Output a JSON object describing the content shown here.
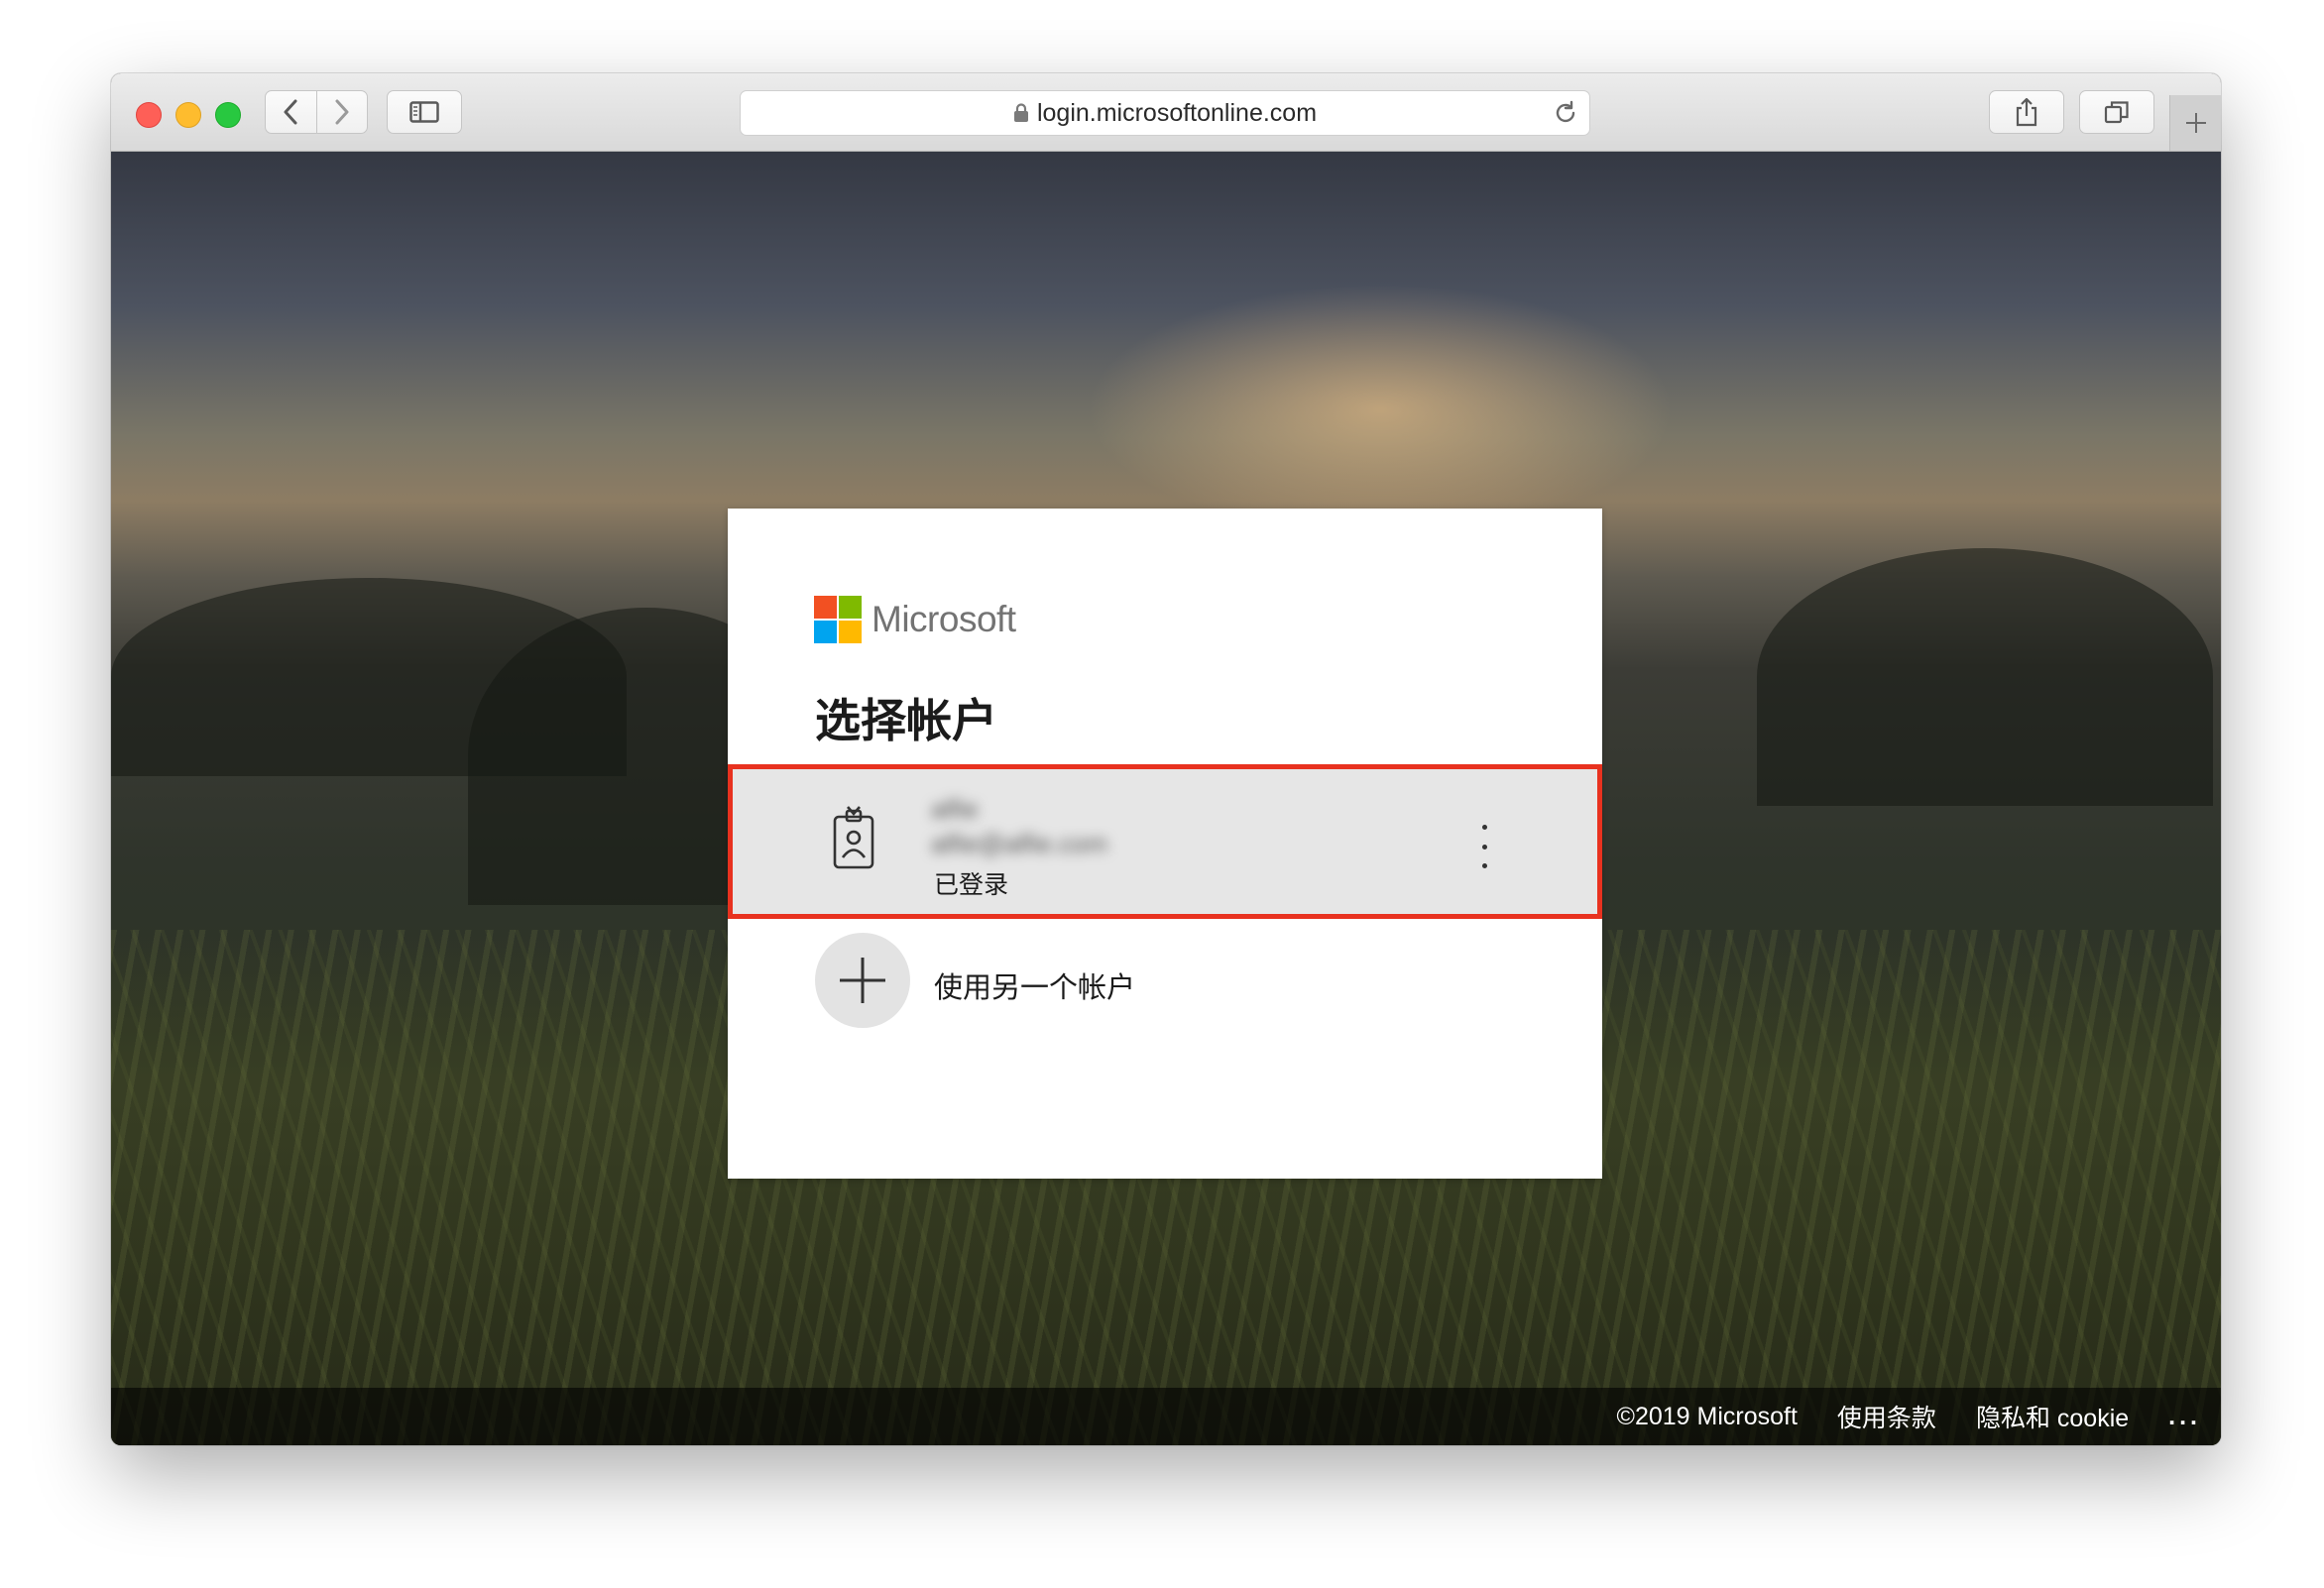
{
  "browser": {
    "url": "login.microsoftonline.com"
  },
  "card": {
    "brand": "Microsoft",
    "title": "选择帐户",
    "account": {
      "name": "alfie",
      "email": "alfie@alfie.com",
      "status": "已登录"
    },
    "other_account_label": "使用另一个帐户"
  },
  "footer": {
    "copyright": "©2019 Microsoft",
    "terms": "使用条款",
    "privacy": "隐私和 cookie",
    "more": "..."
  },
  "colors": {
    "highlight_border": "#e8321f",
    "ms_red": "#f25022",
    "ms_green": "#7fba00",
    "ms_blue": "#00a4ef",
    "ms_yellow": "#ffb900"
  }
}
